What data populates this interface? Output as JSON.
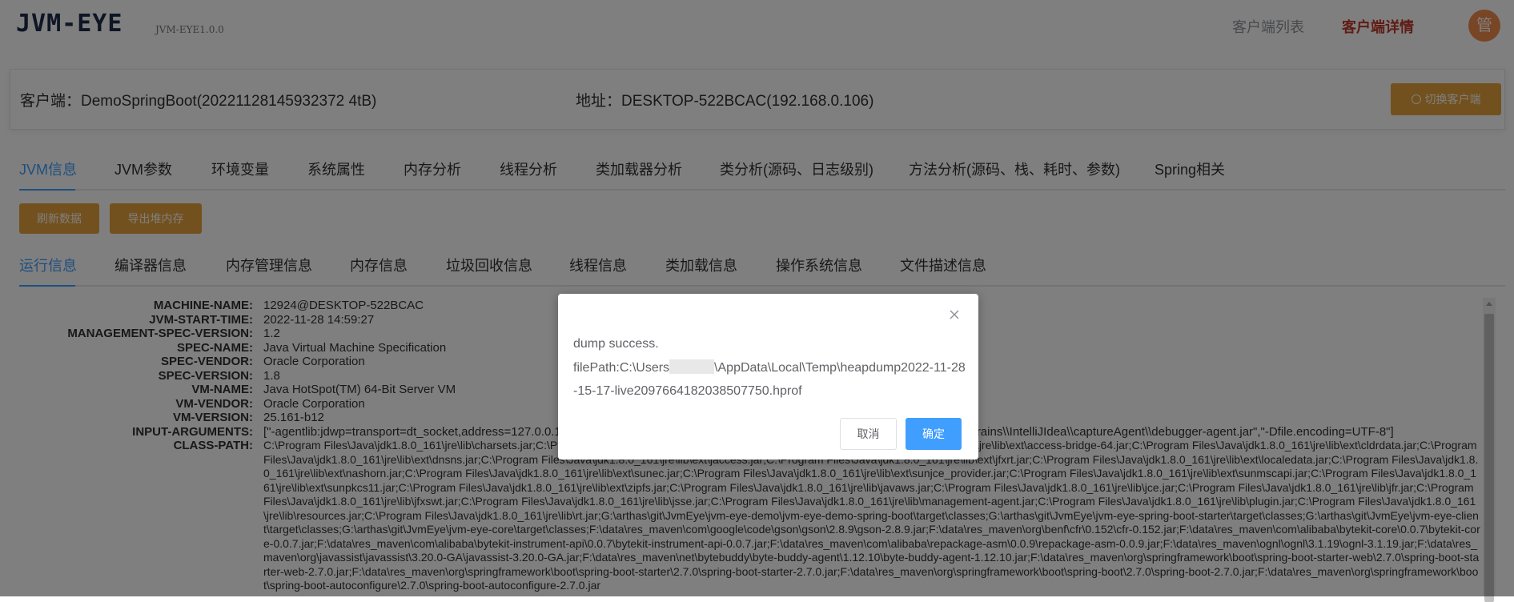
{
  "header": {
    "logo": "JVM-EYE",
    "version": "JVM-EYE1.0.0",
    "nav": [
      "客户端列表",
      "客户端详情"
    ],
    "avatar": "管"
  },
  "client": {
    "name": "客户端：DemoSpringBoot(20221128145932372 4tB)",
    "address": "地址：DESKTOP-522BCAC(192.168.0.106)",
    "switch_button": "切换客户端"
  },
  "main_tabs": [
    "JVM信息",
    "JVM参数",
    "环境变量",
    "系统属性",
    "内存分析",
    "线程分析",
    "类加载器分析",
    "类分析(源码、日志级别)",
    "方法分析(源码、栈、耗时、参数)",
    "Spring相关"
  ],
  "actions": {
    "refresh": "刷新数据",
    "export_heap": "导出堆内存"
  },
  "sub_tabs": [
    "运行信息",
    "编译器信息",
    "内存管理信息",
    "内存信息",
    "垃圾回收信息",
    "线程信息",
    "类加载信息",
    "操作系统信息",
    "文件描述信息"
  ],
  "runtime_info": [
    {
      "key": "MACHINE-NAME:",
      "value": "12924@DESKTOP-522BCAC"
    },
    {
      "key": "JVM-START-TIME:",
      "value": "2022-11-28 14:59:27"
    },
    {
      "key": "MANAGEMENT-SPEC-VERSION:",
      "value": "1.2"
    },
    {
      "key": "SPEC-NAME:",
      "value": "Java Virtual Machine Specification"
    },
    {
      "key": "SPEC-VENDOR:",
      "value": "Oracle Corporation"
    },
    {
      "key": "SPEC-VERSION:",
      "value": "1.8"
    },
    {
      "key": "VM-NAME:",
      "value": "Java HotSpot(TM) 64-Bit Server VM"
    },
    {
      "key": "VM-VENDOR:",
      "value": "Oracle Corporation"
    },
    {
      "key": "VM-VERSION:",
      "value": "25.161-b12"
    },
    {
      "key": "INPUT-ARGUMENTS:",
      "value": "[\"-agentlib:jdwp=transport=dt_socket,address=127.0.0.1:____,suspend=y,server=n\",\"-javaagent:C:\\\\Users\\\\____\\\\AppData\\\\Local\\\\JetBrains\\\\IntelliJIdea\\\\captureAgent\\\\debugger-agent.jar\",\"-Dfile.encoding=UTF-8\"]"
    },
    {
      "key": "CLASS-PATH:",
      "value": ""
    }
  ],
  "class_path": "C:\\Program Files\\Java\\jdk1.8.0_161\\jre\\lib\\charsets.jar;C:\\Program Files\\Java\\jdk1.8.0_161\\jre\\lib\\deploy.jar;C:\\Program Files\\Java\\jdk1.8.0_161\\jre\\lib\\ext\\access-bridge-64.jar;C:\\Program Files\\Java\\jdk1.8.0_161\\jre\\lib\\ext\\cldrdata.jar;C:\\Program Files\\Java\\jdk1.8.0_161\\jre\\lib\\ext\\dnsns.jar;C:\\Program Files\\Java\\jdk1.8.0_161\\jre\\lib\\ext\\jaccess.jar;C:\\Program Files\\Java\\jdk1.8.0_161\\jre\\lib\\ext\\jfxrt.jar;C:\\Program Files\\Java\\jdk1.8.0_161\\jre\\lib\\ext\\localedata.jar;C:\\Program Files\\Java\\jdk1.8.0_161\\jre\\lib\\ext\\nashorn.jar;C:\\Program Files\\Java\\jdk1.8.0_161\\jre\\lib\\ext\\sunec.jar;C:\\Program Files\\Java\\jdk1.8.0_161\\jre\\lib\\ext\\sunjce_provider.jar;C:\\Program Files\\Java\\jdk1.8.0_161\\jre\\lib\\ext\\sunmscapi.jar;C:\\Program Files\\Java\\jdk1.8.0_161\\jre\\lib\\ext\\sunpkcs11.jar;C:\\Program Files\\Java\\jdk1.8.0_161\\jre\\lib\\ext\\zipfs.jar;C:\\Program Files\\Java\\jdk1.8.0_161\\jre\\lib\\javaws.jar;C:\\Program Files\\Java\\jdk1.8.0_161\\jre\\lib\\jce.jar;C:\\Program Files\\Java\\jdk1.8.0_161\\jre\\lib\\jfr.jar;C:\\Program Files\\Java\\jdk1.8.0_161\\jre\\lib\\jfxswt.jar;C:\\Program Files\\Java\\jdk1.8.0_161\\jre\\lib\\jsse.jar;C:\\Program Files\\Java\\jdk1.8.0_161\\jre\\lib\\management-agent.jar;C:\\Program Files\\Java\\jdk1.8.0_161\\jre\\lib\\plugin.jar;C:\\Program Files\\Java\\jdk1.8.0_161\\jre\\lib\\resources.jar;C:\\Program Files\\Java\\jdk1.8.0_161\\jre\\lib\\rt.jar;G:\\arthas\\git\\JvmEye\\jvm-eye-demo\\jvm-eye-demo-spring-boot\\target\\classes;G:\\arthas\\git\\JvmEye\\jvm-eye-spring-boot-starter\\target\\classes;G:\\arthas\\git\\JvmEye\\jvm-eye-client\\target\\classes;G:\\arthas\\git\\JvmEye\\jvm-eye-core\\target\\classes;F:\\data\\res_maven\\com\\google\\code\\gson\\gson\\2.8.9\\gson-2.8.9.jar;F:\\data\\res_maven\\org\\benf\\cfr\\0.152\\cfr-0.152.jar;F:\\data\\res_maven\\com\\alibaba\\bytekit-core\\0.0.7\\bytekit-core-0.0.7.jar;F:\\data\\res_maven\\com\\alibaba\\bytekit-instrument-api\\0.0.7\\bytekit-instrument-api-0.0.7.jar;F:\\data\\res_maven\\com\\alibaba\\repackage-asm\\0.0.9\\repackage-asm-0.0.9.jar;F:\\data\\res_maven\\ognl\\ognl\\3.1.19\\ognl-3.1.19.jar;F:\\data\\res_maven\\org\\javassist\\javassist\\3.20.0-GA\\javassist-3.20.0-GA.jar;F:\\data\\res_maven\\net\\bytebuddy\\byte-buddy-agent\\1.12.10\\byte-buddy-agent-1.12.10.jar;F:\\data\\res_maven\\org\\springframework\\boot\\spring-boot-starter-web\\2.7.0\\spring-boot-starter-web-2.7.0.jar;F:\\data\\res_maven\\org\\springframework\\boot\\spring-boot-starter\\2.7.0\\spring-boot-starter-2.7.0.jar;F:\\data\\res_maven\\org\\springframework\\boot\\spring-boot\\2.7.0\\spring-boot-2.7.0.jar;F:\\data\\res_maven\\org\\springframework\\boot\\spring-boot-autoconfigure\\2.7.0\\spring-boot-autoconfigure-2.7.0.jar",
  "dialog": {
    "line1": "dump success.",
    "path_prefix": "filePath:C:\\Users",
    "path_suffix": "\\AppData\\Local\\Temp\\heapdump2022-11-28-15-17-live2097664182038507750.hprof",
    "cancel": "取消",
    "confirm": "确定"
  },
  "colors": {
    "accent": "#409eff",
    "warning_button": "#e6a23c",
    "active_nav": "#c0392b",
    "avatar": "#f08a4b"
  }
}
